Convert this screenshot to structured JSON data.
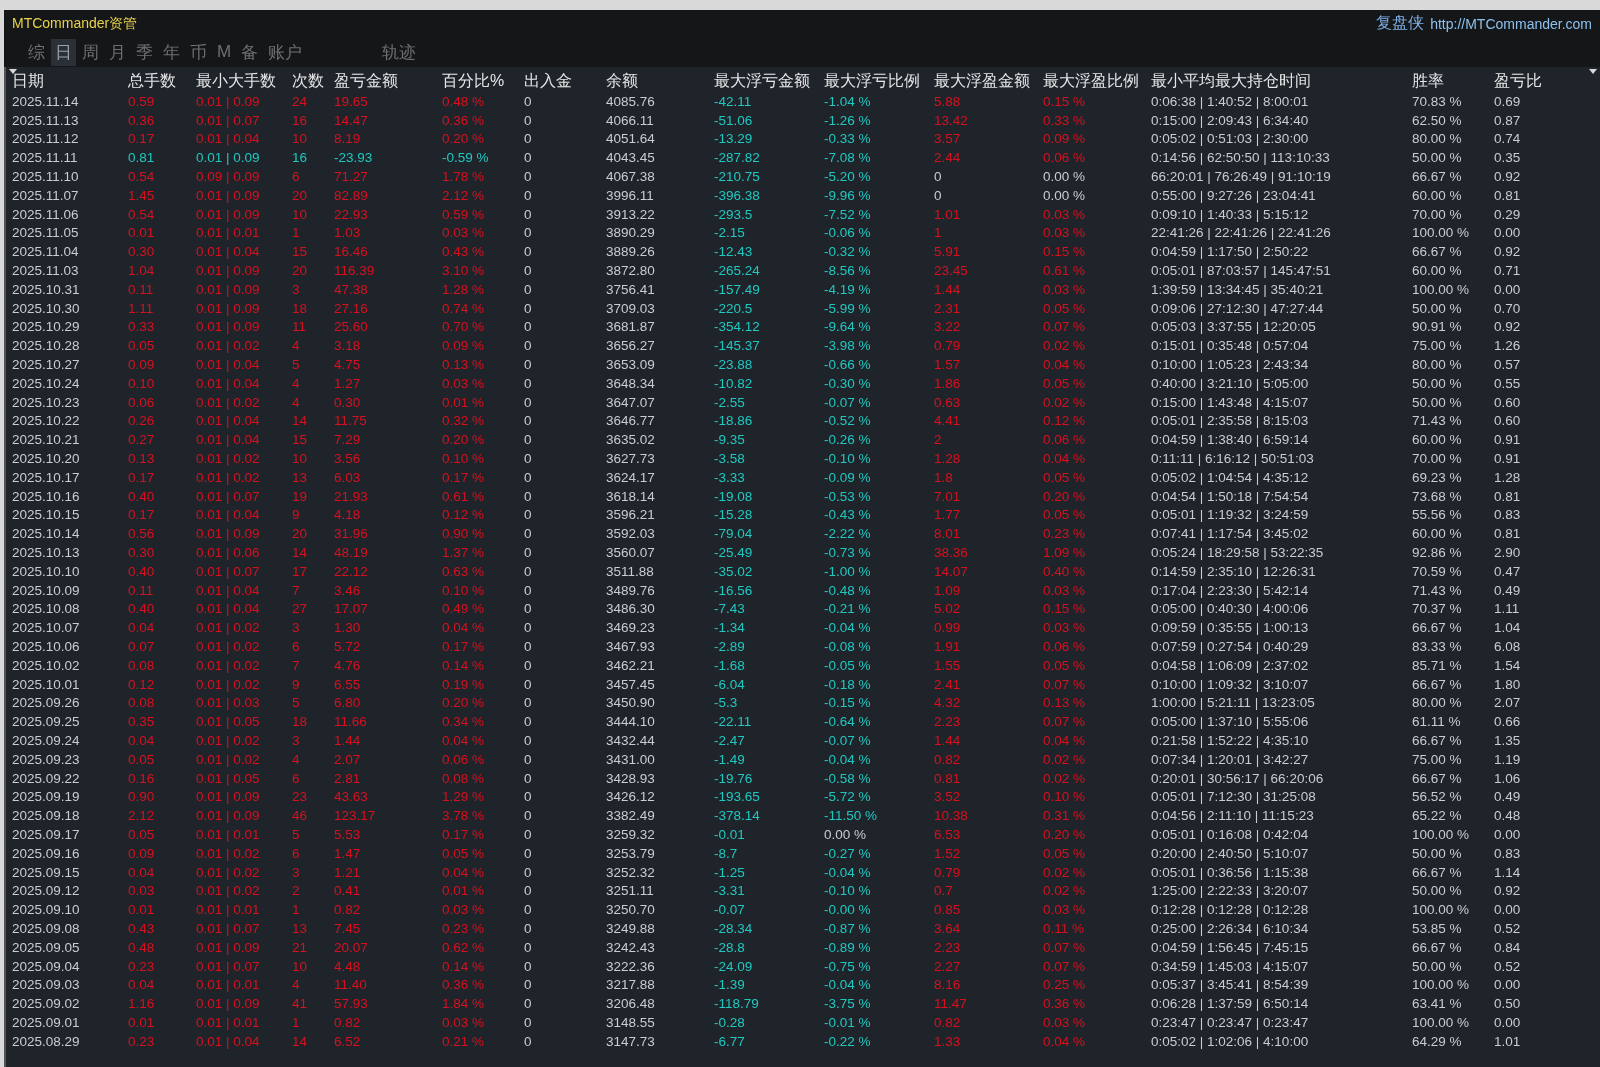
{
  "title_bar": {
    "app_title": "MTCommander资管",
    "brand": "复盘侠",
    "link": "http://MTCommander.com"
  },
  "tabs": [
    {
      "label": "综",
      "selected": false
    },
    {
      "label": "日",
      "selected": true
    },
    {
      "label": "周",
      "selected": false
    },
    {
      "label": "月",
      "selected": false
    },
    {
      "label": "季",
      "selected": false
    },
    {
      "label": "年",
      "selected": false
    },
    {
      "label": "币",
      "selected": false
    },
    {
      "label": "M",
      "selected": false
    },
    {
      "label": "备",
      "selected": false
    },
    {
      "label": "账户",
      "selected": false
    }
  ],
  "side_tabs": [
    {
      "label": "轨迹",
      "selected": false
    }
  ],
  "table": {
    "columns": [
      "日期",
      "总手数",
      "最小大手数",
      "次数",
      "盈亏金额",
      "百分比%",
      "出入金",
      "余额",
      "最大浮亏金额",
      "最大浮亏比例",
      "最大浮盈金额",
      "最大浮盈比例",
      "最小平均最大持仓时间",
      "胜率",
      "盈亏比"
    ],
    "rows": [
      {
        "color": "#d8101e",
        "cells": [
          "2025.11.14",
          "0.59",
          "0.01 | 0.09",
          "24",
          "19.65",
          "0.48 %",
          "0",
          "4085.76"
        ],
        "float_cells": [
          {
            "text": "-42.11",
            "color": "#20c8c0"
          },
          {
            "text": "-1.04 %",
            "color": "#20c8c0"
          },
          {
            "text": "5.88",
            "color": "#d8101e"
          },
          {
            "text": "0.15 %",
            "color": "#d8101e"
          }
        ],
        "tail_cells": [
          "0:06:38 | 1:40:52 | 8:00:01",
          "70.83 %",
          "0.69"
        ]
      },
      {
        "color": "#d8101e",
        "cells": [
          "2025.11.13",
          "0.36",
          "0.01 | 0.07",
          "16",
          "14.47",
          "0.36 %",
          "0",
          "4066.11"
        ],
        "float_cells": [
          {
            "text": "-51.06",
            "color": "#20c8c0"
          },
          {
            "text": "-1.26 %",
            "color": "#20c8c0"
          },
          {
            "text": "13.42",
            "color": "#d8101e"
          },
          {
            "text": "0.33 %",
            "color": "#d8101e"
          }
        ],
        "tail_cells": [
          "0:15:00 | 2:09:43 | 6:34:40",
          "62.50 %",
          "0.87"
        ]
      },
      {
        "color": "#d8101e",
        "cells": [
          "2025.11.12",
          "0.17",
          "0.01 | 0.04",
          "10",
          "8.19",
          "0.20 %",
          "0",
          "4051.64"
        ],
        "float_cells": [
          {
            "text": "-13.29",
            "color": "#20c8c0"
          },
          {
            "text": "-0.33 %",
            "color": "#20c8c0"
          },
          {
            "text": "3.57",
            "color": "#d8101e"
          },
          {
            "text": "0.09 %",
            "color": "#d8101e"
          }
        ],
        "tail_cells": [
          "0:05:02 | 0:51:03 | 2:30:00",
          "80.00 %",
          "0.74"
        ]
      },
      {
        "color": "#20c8c0",
        "cells": [
          "2025.11.11",
          "0.81",
          "0.01 | 0.09",
          "16",
          "-23.93",
          "-0.59 %",
          "0",
          "4043.45"
        ],
        "float_cells": [
          {
            "text": "-287.82",
            "color": "#20c8c0"
          },
          {
            "text": "-7.08 %",
            "color": "#20c8c0"
          },
          {
            "text": "2.44",
            "color": "#d8101e"
          },
          {
            "text": "0.06 %",
            "color": "#d8101e"
          }
        ],
        "tail_cells": [
          "0:14:56 | 62:50:50 | 113:10:33",
          "50.00 %",
          "0.35"
        ]
      },
      {
        "color": "#d8101e",
        "cells": [
          "2025.11.10",
          "0.54",
          "0.09 | 0.09",
          "6",
          "71.27",
          "1.78 %",
          "0",
          "4067.38"
        ],
        "float_cells": [
          {
            "text": "-210.75",
            "color": "#20c8c0"
          },
          {
            "text": "-5.20 %",
            "color": "#20c8c0"
          },
          {
            "text": "0",
            "color": "#c9ccd0"
          },
          {
            "text": "0.00 %",
            "color": "#c9ccd0"
          }
        ],
        "tail_cells": [
          "66:20:01 | 76:26:49 | 91:10:19",
          "66.67 %",
          "0.92"
        ]
      },
      {
        "color": "#d8101e",
        "cells": [
          "2025.11.07",
          "1.45",
          "0.01 | 0.09",
          "20",
          "82.89",
          "2.12 %",
          "0",
          "3996.11"
        ],
        "float_cells": [
          {
            "text": "-396.38",
            "color": "#20c8c0"
          },
          {
            "text": "-9.96 %",
            "color": "#20c8c0"
          },
          {
            "text": "0",
            "color": "#c9ccd0"
          },
          {
            "text": "0.00 %",
            "color": "#c9ccd0"
          }
        ],
        "tail_cells": [
          "0:55:00 | 9:27:26 | 23:04:41",
          "60.00 %",
          "0.81"
        ]
      },
      {
        "color": "#d8101e",
        "cells": [
          "2025.11.06",
          "0.54",
          "0.01 | 0.09",
          "10",
          "22.93",
          "0.59 %",
          "0",
          "3913.22"
        ],
        "float_cells": [
          {
            "text": "-293.5",
            "color": "#20c8c0"
          },
          {
            "text": "-7.52 %",
            "color": "#20c8c0"
          },
          {
            "text": "1.01",
            "color": "#d8101e"
          },
          {
            "text": "0.03 %",
            "color": "#d8101e"
          }
        ],
        "tail_cells": [
          "0:09:10 | 1:40:33 | 5:15:12",
          "70.00 %",
          "0.29"
        ]
      },
      {
        "color": "#d8101e",
        "cells": [
          "2025.11.05",
          "0.01",
          "0.01 | 0.01",
          "1",
          "1.03",
          "0.03 %",
          "0",
          "3890.29"
        ],
        "float_cells": [
          {
            "text": "-2.15",
            "color": "#20c8c0"
          },
          {
            "text": "-0.06 %",
            "color": "#20c8c0"
          },
          {
            "text": "1",
            "color": "#d8101e"
          },
          {
            "text": "0.03 %",
            "color": "#d8101e"
          }
        ],
        "tail_cells": [
          "22:41:26 | 22:41:26 | 22:41:26",
          "100.00 %",
          "0.00"
        ]
      },
      {
        "color": "#d8101e",
        "cells": [
          "2025.11.04",
          "0.30",
          "0.01 | 0.04",
          "15",
          "16.46",
          "0.43 %",
          "0",
          "3889.26"
        ],
        "float_cells": [
          {
            "text": "-12.43",
            "color": "#20c8c0"
          },
          {
            "text": "-0.32 %",
            "color": "#20c8c0"
          },
          {
            "text": "5.91",
            "color": "#d8101e"
          },
          {
            "text": "0.15 %",
            "color": "#d8101e"
          }
        ],
        "tail_cells": [
          "0:04:59 | 1:17:50 | 2:50:22",
          "66.67 %",
          "0.92"
        ]
      },
      {
        "color": "#d8101e",
        "cells": [
          "2025.11.03",
          "1.04",
          "0.01 | 0.09",
          "20",
          "116.39",
          "3.10 %",
          "0",
          "3872.80"
        ],
        "float_cells": [
          {
            "text": "-265.24",
            "color": "#20c8c0"
          },
          {
            "text": "-8.56 %",
            "color": "#20c8c0"
          },
          {
            "text": "23.45",
            "color": "#d8101e"
          },
          {
            "text": "0.61 %",
            "color": "#d8101e"
          }
        ],
        "tail_cells": [
          "0:05:01 | 87:03:57 | 145:47:51",
          "60.00 %",
          "0.71"
        ]
      },
      {
        "color": "#d8101e",
        "cells": [
          "2025.10.31",
          "0.11",
          "0.01 | 0.09",
          "3",
          "47.38",
          "1.28 %",
          "0",
          "3756.41"
        ],
        "float_cells": [
          {
            "text": "-157.49",
            "color": "#20c8c0"
          },
          {
            "text": "-4.19 %",
            "color": "#20c8c0"
          },
          {
            "text": "1.44",
            "color": "#d8101e"
          },
          {
            "text": "0.03 %",
            "color": "#d8101e"
          }
        ],
        "tail_cells": [
          "1:39:59 | 13:34:45 | 35:40:21",
          "100.00 %",
          "0.00"
        ]
      },
      {
        "color": "#d8101e",
        "cells": [
          "2025.10.30",
          "1.11",
          "0.01 | 0.09",
          "18",
          "27.16",
          "0.74 %",
          "0",
          "3709.03"
        ],
        "float_cells": [
          {
            "text": "-220.5",
            "color": "#20c8c0"
          },
          {
            "text": "-5.99 %",
            "color": "#20c8c0"
          },
          {
            "text": "2.31",
            "color": "#d8101e"
          },
          {
            "text": "0.05 %",
            "color": "#d8101e"
          }
        ],
        "tail_cells": [
          "0:09:06 | 27:12:30 | 47:27:44",
          "50.00 %",
          "0.70"
        ]
      },
      {
        "color": "#d8101e",
        "cells": [
          "2025.10.29",
          "0.33",
          "0.01 | 0.09",
          "11",
          "25.60",
          "0.70 %",
          "0",
          "3681.87"
        ],
        "float_cells": [
          {
            "text": "-354.12",
            "color": "#20c8c0"
          },
          {
            "text": "-9.64 %",
            "color": "#20c8c0"
          },
          {
            "text": "3.22",
            "color": "#d8101e"
          },
          {
            "text": "0.07 %",
            "color": "#d8101e"
          }
        ],
        "tail_cells": [
          "0:05:03 | 3:37:55 | 12:20:05",
          "90.91 %",
          "0.92"
        ]
      },
      {
        "color": "#d8101e",
        "cells": [
          "2025.10.28",
          "0.05",
          "0.01 | 0.02",
          "4",
          "3.18",
          "0.09 %",
          "0",
          "3656.27"
        ],
        "float_cells": [
          {
            "text": "-145.37",
            "color": "#20c8c0"
          },
          {
            "text": "-3.98 %",
            "color": "#20c8c0"
          },
          {
            "text": "0.79",
            "color": "#d8101e"
          },
          {
            "text": "0.02 %",
            "color": "#d8101e"
          }
        ],
        "tail_cells": [
          "0:15:01 | 0:35:48 | 0:57:04",
          "75.00 %",
          "1.26"
        ]
      },
      {
        "color": "#d8101e",
        "cells": [
          "2025.10.27",
          "0.09",
          "0.01 | 0.04",
          "5",
          "4.75",
          "0.13 %",
          "0",
          "3653.09"
        ],
        "float_cells": [
          {
            "text": "-23.88",
            "color": "#20c8c0"
          },
          {
            "text": "-0.66 %",
            "color": "#20c8c0"
          },
          {
            "text": "1.57",
            "color": "#d8101e"
          },
          {
            "text": "0.04 %",
            "color": "#d8101e"
          }
        ],
        "tail_cells": [
          "0:10:00 | 1:05:23 | 2:43:34",
          "80.00 %",
          "0.57"
        ]
      },
      {
        "color": "#d8101e",
        "cells": [
          "2025.10.24",
          "0.10",
          "0.01 | 0.04",
          "4",
          "1.27",
          "0.03 %",
          "0",
          "3648.34"
        ],
        "float_cells": [
          {
            "text": "-10.82",
            "color": "#20c8c0"
          },
          {
            "text": "-0.30 %",
            "color": "#20c8c0"
          },
          {
            "text": "1.86",
            "color": "#d8101e"
          },
          {
            "text": "0.05 %",
            "color": "#d8101e"
          }
        ],
        "tail_cells": [
          "0:40:00 | 3:21:10 | 5:05:00",
          "50.00 %",
          "0.55"
        ]
      },
      {
        "color": "#d8101e",
        "cells": [
          "2025.10.23",
          "0.06",
          "0.01 | 0.02",
          "4",
          "0.30",
          "0.01 %",
          "0",
          "3647.07"
        ],
        "float_cells": [
          {
            "text": "-2.55",
            "color": "#20c8c0"
          },
          {
            "text": "-0.07 %",
            "color": "#20c8c0"
          },
          {
            "text": "0.63",
            "color": "#d8101e"
          },
          {
            "text": "0.02 %",
            "color": "#d8101e"
          }
        ],
        "tail_cells": [
          "0:15:00 | 1:43:48 | 4:15:07",
          "50.00 %",
          "0.60"
        ]
      },
      {
        "color": "#d8101e",
        "cells": [
          "2025.10.22",
          "0.26",
          "0.01 | 0.04",
          "14",
          "11.75",
          "0.32 %",
          "0",
          "3646.77"
        ],
        "float_cells": [
          {
            "text": "-18.86",
            "color": "#20c8c0"
          },
          {
            "text": "-0.52 %",
            "color": "#20c8c0"
          },
          {
            "text": "4.41",
            "color": "#d8101e"
          },
          {
            "text": "0.12 %",
            "color": "#d8101e"
          }
        ],
        "tail_cells": [
          "0:05:01 | 2:35:58 | 8:15:03",
          "71.43 %",
          "0.60"
        ]
      },
      {
        "color": "#d8101e",
        "cells": [
          "2025.10.21",
          "0.27",
          "0.01 | 0.04",
          "15",
          "7.29",
          "0.20 %",
          "0",
          "3635.02"
        ],
        "float_cells": [
          {
            "text": "-9.35",
            "color": "#20c8c0"
          },
          {
            "text": "-0.26 %",
            "color": "#20c8c0"
          },
          {
            "text": "2",
            "color": "#d8101e"
          },
          {
            "text": "0.06 %",
            "color": "#d8101e"
          }
        ],
        "tail_cells": [
          "0:04:59 | 1:38:40 | 6:59:14",
          "60.00 %",
          "0.91"
        ]
      },
      {
        "color": "#d8101e",
        "cells": [
          "2025.10.20",
          "0.13",
          "0.01 | 0.02",
          "10",
          "3.56",
          "0.10 %",
          "0",
          "3627.73"
        ],
        "float_cells": [
          {
            "text": "-3.58",
            "color": "#20c8c0"
          },
          {
            "text": "-0.10 %",
            "color": "#20c8c0"
          },
          {
            "text": "1.28",
            "color": "#d8101e"
          },
          {
            "text": "0.04 %",
            "color": "#d8101e"
          }
        ],
        "tail_cells": [
          "0:11:11 | 6:16:12 | 50:51:03",
          "70.00 %",
          "0.91"
        ]
      },
      {
        "color": "#d8101e",
        "cells": [
          "2025.10.17",
          "0.17",
          "0.01 | 0.02",
          "13",
          "6.03",
          "0.17 %",
          "0",
          "3624.17"
        ],
        "float_cells": [
          {
            "text": "-3.33",
            "color": "#20c8c0"
          },
          {
            "text": "-0.09 %",
            "color": "#20c8c0"
          },
          {
            "text": "1.8",
            "color": "#d8101e"
          },
          {
            "text": "0.05 %",
            "color": "#d8101e"
          }
        ],
        "tail_cells": [
          "0:05:02 | 1:04:54 | 4:35:12",
          "69.23 %",
          "1.28"
        ]
      },
      {
        "color": "#d8101e",
        "cells": [
          "2025.10.16",
          "0.40",
          "0.01 | 0.07",
          "19",
          "21.93",
          "0.61 %",
          "0",
          "3618.14"
        ],
        "float_cells": [
          {
            "text": "-19.08",
            "color": "#20c8c0"
          },
          {
            "text": "-0.53 %",
            "color": "#20c8c0"
          },
          {
            "text": "7.01",
            "color": "#d8101e"
          },
          {
            "text": "0.20 %",
            "color": "#d8101e"
          }
        ],
        "tail_cells": [
          "0:04:54 | 1:50:18 | 7:54:54",
          "73.68 %",
          "0.81"
        ]
      },
      {
        "color": "#d8101e",
        "cells": [
          "2025.10.15",
          "0.17",
          "0.01 | 0.04",
          "9",
          "4.18",
          "0.12 %",
          "0",
          "3596.21"
        ],
        "float_cells": [
          {
            "text": "-15.28",
            "color": "#20c8c0"
          },
          {
            "text": "-0.43 %",
            "color": "#20c8c0"
          },
          {
            "text": "1.77",
            "color": "#d8101e"
          },
          {
            "text": "0.05 %",
            "color": "#d8101e"
          }
        ],
        "tail_cells": [
          "0:05:01 | 1:19:32 | 3:24:59",
          "55.56 %",
          "0.83"
        ]
      },
      {
        "color": "#d8101e",
        "cells": [
          "2025.10.14",
          "0.56",
          "0.01 | 0.09",
          "20",
          "31.96",
          "0.90 %",
          "0",
          "3592.03"
        ],
        "float_cells": [
          {
            "text": "-79.04",
            "color": "#20c8c0"
          },
          {
            "text": "-2.22 %",
            "color": "#20c8c0"
          },
          {
            "text": "8.01",
            "color": "#d8101e"
          },
          {
            "text": "0.23 %",
            "color": "#d8101e"
          }
        ],
        "tail_cells": [
          "0:07:41 | 1:17:54 | 3:45:02",
          "60.00 %",
          "0.81"
        ]
      },
      {
        "color": "#d8101e",
        "cells": [
          "2025.10.13",
          "0.30",
          "0.01 | 0.06",
          "14",
          "48.19",
          "1.37 %",
          "0",
          "3560.07"
        ],
        "float_cells": [
          {
            "text": "-25.49",
            "color": "#20c8c0"
          },
          {
            "text": "-0.73 %",
            "color": "#20c8c0"
          },
          {
            "text": "38.36",
            "color": "#d8101e"
          },
          {
            "text": "1.09 %",
            "color": "#d8101e"
          }
        ],
        "tail_cells": [
          "0:05:24 | 18:29:58 | 53:22:35",
          "92.86 %",
          "2.90"
        ]
      },
      {
        "color": "#d8101e",
        "cells": [
          "2025.10.10",
          "0.40",
          "0.01 | 0.07",
          "17",
          "22.12",
          "0.63 %",
          "0",
          "3511.88"
        ],
        "float_cells": [
          {
            "text": "-35.02",
            "color": "#20c8c0"
          },
          {
            "text": "-1.00 %",
            "color": "#20c8c0"
          },
          {
            "text": "14.07",
            "color": "#d8101e"
          },
          {
            "text": "0.40 %",
            "color": "#d8101e"
          }
        ],
        "tail_cells": [
          "0:14:59 | 2:35:10 | 12:26:31",
          "70.59 %",
          "0.47"
        ]
      },
      {
        "color": "#d8101e",
        "cells": [
          "2025.10.09",
          "0.11",
          "0.01 | 0.04",
          "7",
          "3.46",
          "0.10 %",
          "0",
          "3489.76"
        ],
        "float_cells": [
          {
            "text": "-16.56",
            "color": "#20c8c0"
          },
          {
            "text": "-0.48 %",
            "color": "#20c8c0"
          },
          {
            "text": "1.09",
            "color": "#d8101e"
          },
          {
            "text": "0.03 %",
            "color": "#d8101e"
          }
        ],
        "tail_cells": [
          "0:17:04 | 2:23:30 | 5:42:14",
          "71.43 %",
          "0.49"
        ]
      },
      {
        "color": "#d8101e",
        "cells": [
          "2025.10.08",
          "0.40",
          "0.01 | 0.04",
          "27",
          "17.07",
          "0.49 %",
          "0",
          "3486.30"
        ],
        "float_cells": [
          {
            "text": "-7.43",
            "color": "#20c8c0"
          },
          {
            "text": "-0.21 %",
            "color": "#20c8c0"
          },
          {
            "text": "5.02",
            "color": "#d8101e"
          },
          {
            "text": "0.15 %",
            "color": "#d8101e"
          }
        ],
        "tail_cells": [
          "0:05:00 | 0:40:30 | 4:00:06",
          "70.37 %",
          "1.11"
        ]
      },
      {
        "color": "#d8101e",
        "cells": [
          "2025.10.07",
          "0.04",
          "0.01 | 0.02",
          "3",
          "1.30",
          "0.04 %",
          "0",
          "3469.23"
        ],
        "float_cells": [
          {
            "text": "-1.34",
            "color": "#20c8c0"
          },
          {
            "text": "-0.04 %",
            "color": "#20c8c0"
          },
          {
            "text": "0.99",
            "color": "#d8101e"
          },
          {
            "text": "0.03 %",
            "color": "#d8101e"
          }
        ],
        "tail_cells": [
          "0:09:59 | 0:35:55 | 1:00:13",
          "66.67 %",
          "1.04"
        ]
      },
      {
        "color": "#d8101e",
        "cells": [
          "2025.10.06",
          "0.07",
          "0.01 | 0.02",
          "6",
          "5.72",
          "0.17 %",
          "0",
          "3467.93"
        ],
        "float_cells": [
          {
            "text": "-2.89",
            "color": "#20c8c0"
          },
          {
            "text": "-0.08 %",
            "color": "#20c8c0"
          },
          {
            "text": "1.91",
            "color": "#d8101e"
          },
          {
            "text": "0.06 %",
            "color": "#d8101e"
          }
        ],
        "tail_cells": [
          "0:07:59 | 0:27:54 | 0:40:29",
          "83.33 %",
          "6.08"
        ]
      },
      {
        "color": "#d8101e",
        "cells": [
          "2025.10.02",
          "0.08",
          "0.01 | 0.02",
          "7",
          "4.76",
          "0.14 %",
          "0",
          "3462.21"
        ],
        "float_cells": [
          {
            "text": "-1.68",
            "color": "#20c8c0"
          },
          {
            "text": "-0.05 %",
            "color": "#20c8c0"
          },
          {
            "text": "1.55",
            "color": "#d8101e"
          },
          {
            "text": "0.05 %",
            "color": "#d8101e"
          }
        ],
        "tail_cells": [
          "0:04:58 | 1:06:09 | 2:37:02",
          "85.71 %",
          "1.54"
        ]
      },
      {
        "color": "#d8101e",
        "cells": [
          "2025.10.01",
          "0.12",
          "0.01 | 0.02",
          "9",
          "6.55",
          "0.19 %",
          "0",
          "3457.45"
        ],
        "float_cells": [
          {
            "text": "-6.04",
            "color": "#20c8c0"
          },
          {
            "text": "-0.18 %",
            "color": "#20c8c0"
          },
          {
            "text": "2.41",
            "color": "#d8101e"
          },
          {
            "text": "0.07 %",
            "color": "#d8101e"
          }
        ],
        "tail_cells": [
          "0:10:00 | 1:09:32 | 3:10:07",
          "66.67 %",
          "1.80"
        ]
      },
      {
        "color": "#d8101e",
        "cells": [
          "2025.09.26",
          "0.08",
          "0.01 | 0.03",
          "5",
          "6.80",
          "0.20 %",
          "0",
          "3450.90"
        ],
        "float_cells": [
          {
            "text": "-5.3",
            "color": "#20c8c0"
          },
          {
            "text": "-0.15 %",
            "color": "#20c8c0"
          },
          {
            "text": "4.32",
            "color": "#d8101e"
          },
          {
            "text": "0.13 %",
            "color": "#d8101e"
          }
        ],
        "tail_cells": [
          "1:00:00 | 5:21:11 | 13:23:05",
          "80.00 %",
          "2.07"
        ]
      },
      {
        "color": "#d8101e",
        "cells": [
          "2025.09.25",
          "0.35",
          "0.01 | 0.05",
          "18",
          "11.66",
          "0.34 %",
          "0",
          "3444.10"
        ],
        "float_cells": [
          {
            "text": "-22.11",
            "color": "#20c8c0"
          },
          {
            "text": "-0.64 %",
            "color": "#20c8c0"
          },
          {
            "text": "2.23",
            "color": "#d8101e"
          },
          {
            "text": "0.07 %",
            "color": "#d8101e"
          }
        ],
        "tail_cells": [
          "0:05:00 | 1:37:10 | 5:55:06",
          "61.11 %",
          "0.66"
        ]
      },
      {
        "color": "#d8101e",
        "cells": [
          "2025.09.24",
          "0.04",
          "0.01 | 0.02",
          "3",
          "1.44",
          "0.04 %",
          "0",
          "3432.44"
        ],
        "float_cells": [
          {
            "text": "-2.47",
            "color": "#20c8c0"
          },
          {
            "text": "-0.07 %",
            "color": "#20c8c0"
          },
          {
            "text": "1.44",
            "color": "#d8101e"
          },
          {
            "text": "0.04 %",
            "color": "#d8101e"
          }
        ],
        "tail_cells": [
          "0:21:58 | 1:52:22 | 4:35:10",
          "66.67 %",
          "1.35"
        ]
      },
      {
        "color": "#d8101e",
        "cells": [
          "2025.09.23",
          "0.05",
          "0.01 | 0.02",
          "4",
          "2.07",
          "0.06 %",
          "0",
          "3431.00"
        ],
        "float_cells": [
          {
            "text": "-1.49",
            "color": "#20c8c0"
          },
          {
            "text": "-0.04 %",
            "color": "#20c8c0"
          },
          {
            "text": "0.82",
            "color": "#d8101e"
          },
          {
            "text": "0.02 %",
            "color": "#d8101e"
          }
        ],
        "tail_cells": [
          "0:07:34 | 1:20:01 | 3:42:27",
          "75.00 %",
          "1.19"
        ]
      },
      {
        "color": "#d8101e",
        "cells": [
          "2025.09.22",
          "0.16",
          "0.01 | 0.05",
          "6",
          "2.81",
          "0.08 %",
          "0",
          "3428.93"
        ],
        "float_cells": [
          {
            "text": "-19.76",
            "color": "#20c8c0"
          },
          {
            "text": "-0.58 %",
            "color": "#20c8c0"
          },
          {
            "text": "0.81",
            "color": "#d8101e"
          },
          {
            "text": "0.02 %",
            "color": "#d8101e"
          }
        ],
        "tail_cells": [
          "0:20:01 | 30:56:17 | 66:20:06",
          "66.67 %",
          "1.06"
        ]
      },
      {
        "color": "#d8101e",
        "cells": [
          "2025.09.19",
          "0.90",
          "0.01 | 0.09",
          "23",
          "43.63",
          "1.29 %",
          "0",
          "3426.12"
        ],
        "float_cells": [
          {
            "text": "-193.65",
            "color": "#20c8c0"
          },
          {
            "text": "-5.72 %",
            "color": "#20c8c0"
          },
          {
            "text": "3.52",
            "color": "#d8101e"
          },
          {
            "text": "0.10 %",
            "color": "#d8101e"
          }
        ],
        "tail_cells": [
          "0:05:01 | 7:12:30 | 31:25:08",
          "56.52 %",
          "0.49"
        ]
      },
      {
        "color": "#d8101e",
        "cells": [
          "2025.09.18",
          "2.12",
          "0.01 | 0.09",
          "46",
          "123.17",
          "3.78 %",
          "0",
          "3382.49"
        ],
        "float_cells": [
          {
            "text": "-378.14",
            "color": "#20c8c0"
          },
          {
            "text": "-11.50 %",
            "color": "#20c8c0"
          },
          {
            "text": "10.38",
            "color": "#d8101e"
          },
          {
            "text": "0.31 %",
            "color": "#d8101e"
          }
        ],
        "tail_cells": [
          "0:04:56 | 2:11:10 | 11:15:23",
          "65.22 %",
          "0.48"
        ]
      },
      {
        "color": "#d8101e",
        "cells": [
          "2025.09.17",
          "0.05",
          "0.01 | 0.01",
          "5",
          "5.53",
          "0.17 %",
          "0",
          "3259.32"
        ],
        "float_cells": [
          {
            "text": "-0.01",
            "color": "#20c8c0"
          },
          {
            "text": "0.00 %",
            "color": "#c9ccd0"
          },
          {
            "text": "6.53",
            "color": "#d8101e"
          },
          {
            "text": "0.20 %",
            "color": "#d8101e"
          }
        ],
        "tail_cells": [
          "0:05:01 | 0:16:08 | 0:42:04",
          "100.00 %",
          "0.00"
        ]
      },
      {
        "color": "#d8101e",
        "cells": [
          "2025.09.16",
          "0.09",
          "0.01 | 0.02",
          "6",
          "1.47",
          "0.05 %",
          "0",
          "3253.79"
        ],
        "float_cells": [
          {
            "text": "-8.7",
            "color": "#20c8c0"
          },
          {
            "text": "-0.27 %",
            "color": "#20c8c0"
          },
          {
            "text": "1.52",
            "color": "#d8101e"
          },
          {
            "text": "0.05 %",
            "color": "#d8101e"
          }
        ],
        "tail_cells": [
          "0:20:00 | 2:40:50 | 5:10:07",
          "50.00 %",
          "0.83"
        ]
      },
      {
        "color": "#d8101e",
        "cells": [
          "2025.09.15",
          "0.04",
          "0.01 | 0.02",
          "3",
          "1.21",
          "0.04 %",
          "0",
          "3252.32"
        ],
        "float_cells": [
          {
            "text": "-1.25",
            "color": "#20c8c0"
          },
          {
            "text": "-0.04 %",
            "color": "#20c8c0"
          },
          {
            "text": "0.79",
            "color": "#d8101e"
          },
          {
            "text": "0.02 %",
            "color": "#d8101e"
          }
        ],
        "tail_cells": [
          "0:05:01 | 0:36:56 | 1:15:38",
          "66.67 %",
          "1.14"
        ]
      },
      {
        "color": "#d8101e",
        "cells": [
          "2025.09.12",
          "0.03",
          "0.01 | 0.02",
          "2",
          "0.41",
          "0.01 %",
          "0",
          "3251.11"
        ],
        "float_cells": [
          {
            "text": "-3.31",
            "color": "#20c8c0"
          },
          {
            "text": "-0.10 %",
            "color": "#20c8c0"
          },
          {
            "text": "0.7",
            "color": "#d8101e"
          },
          {
            "text": "0.02 %",
            "color": "#d8101e"
          }
        ],
        "tail_cells": [
          "1:25:00 | 2:22:33 | 3:20:07",
          "50.00 %",
          "0.92"
        ]
      },
      {
        "color": "#d8101e",
        "cells": [
          "2025.09.10",
          "0.01",
          "0.01 | 0.01",
          "1",
          "0.82",
          "0.03 %",
          "0",
          "3250.70"
        ],
        "float_cells": [
          {
            "text": "-0.07",
            "color": "#20c8c0"
          },
          {
            "text": "-0.00 %",
            "color": "#20c8c0"
          },
          {
            "text": "0.85",
            "color": "#d8101e"
          },
          {
            "text": "0.03 %",
            "color": "#d8101e"
          }
        ],
        "tail_cells": [
          "0:12:28 | 0:12:28 | 0:12:28",
          "100.00 %",
          "0.00"
        ]
      },
      {
        "color": "#d8101e",
        "cells": [
          "2025.09.08",
          "0.43",
          "0.01 | 0.07",
          "13",
          "7.45",
          "0.23 %",
          "0",
          "3249.88"
        ],
        "float_cells": [
          {
            "text": "-28.34",
            "color": "#20c8c0"
          },
          {
            "text": "-0.87 %",
            "color": "#20c8c0"
          },
          {
            "text": "3.64",
            "color": "#d8101e"
          },
          {
            "text": "0.11 %",
            "color": "#d8101e"
          }
        ],
        "tail_cells": [
          "0:25:00 | 2:26:34 | 6:10:34",
          "53.85 %",
          "0.52"
        ]
      },
      {
        "color": "#d8101e",
        "cells": [
          "2025.09.05",
          "0.48",
          "0.01 | 0.09",
          "21",
          "20.07",
          "0.62 %",
          "0",
          "3242.43"
        ],
        "float_cells": [
          {
            "text": "-28.8",
            "color": "#20c8c0"
          },
          {
            "text": "-0.89 %",
            "color": "#20c8c0"
          },
          {
            "text": "2.23",
            "color": "#d8101e"
          },
          {
            "text": "0.07 %",
            "color": "#d8101e"
          }
        ],
        "tail_cells": [
          "0:04:59 | 1:56:45 | 7:45:15",
          "66.67 %",
          "0.84"
        ]
      },
      {
        "color": "#d8101e",
        "cells": [
          "2025.09.04",
          "0.23",
          "0.01 | 0.07",
          "10",
          "4.48",
          "0.14 %",
          "0",
          "3222.36"
        ],
        "float_cells": [
          {
            "text": "-24.09",
            "color": "#20c8c0"
          },
          {
            "text": "-0.75 %",
            "color": "#20c8c0"
          },
          {
            "text": "2.27",
            "color": "#d8101e"
          },
          {
            "text": "0.07 %",
            "color": "#d8101e"
          }
        ],
        "tail_cells": [
          "0:34:59 | 1:45:03 | 4:15:07",
          "50.00 %",
          "0.52"
        ]
      },
      {
        "color": "#d8101e",
        "cells": [
          "2025.09.03",
          "0.04",
          "0.01 | 0.01",
          "4",
          "11.40",
          "0.36 %",
          "0",
          "3217.88"
        ],
        "float_cells": [
          {
            "text": "-1.39",
            "color": "#20c8c0"
          },
          {
            "text": "-0.04 %",
            "color": "#20c8c0"
          },
          {
            "text": "8.16",
            "color": "#d8101e"
          },
          {
            "text": "0.25 %",
            "color": "#d8101e"
          }
        ],
        "tail_cells": [
          "0:05:37 | 3:45:41 | 8:54:39",
          "100.00 %",
          "0.00"
        ]
      },
      {
        "color": "#d8101e",
        "cells": [
          "2025.09.02",
          "1.16",
          "0.01 | 0.09",
          "41",
          "57.93",
          "1.84 %",
          "0",
          "3206.48"
        ],
        "float_cells": [
          {
            "text": "-118.79",
            "color": "#20c8c0"
          },
          {
            "text": "-3.75 %",
            "color": "#20c8c0"
          },
          {
            "text": "11.47",
            "color": "#d8101e"
          },
          {
            "text": "0.36 %",
            "color": "#d8101e"
          }
        ],
        "tail_cells": [
          "0:06:28 | 1:37:59 | 6:50:14",
          "63.41 %",
          "0.50"
        ]
      },
      {
        "color": "#d8101e",
        "cells": [
          "2025.09.01",
          "0.01",
          "0.01 | 0.01",
          "1",
          "0.82",
          "0.03 %",
          "0",
          "3148.55"
        ],
        "float_cells": [
          {
            "text": "-0.28",
            "color": "#20c8c0"
          },
          {
            "text": "-0.01 %",
            "color": "#20c8c0"
          },
          {
            "text": "0.82",
            "color": "#d8101e"
          },
          {
            "text": "0.03 %",
            "color": "#d8101e"
          }
        ],
        "tail_cells": [
          "0:23:47 | 0:23:47 | 0:23:47",
          "100.00 %",
          "0.00"
        ]
      },
      {
        "color": "#d8101e",
        "cells": [
          "2025.08.29",
          "0.23",
          "0.01 | 0.04",
          "14",
          "6.52",
          "0.21 %",
          "0",
          "3147.73"
        ],
        "float_cells": [
          {
            "text": "-6.77",
            "color": "#20c8c0"
          },
          {
            "text": "-0.22 %",
            "color": "#20c8c0"
          },
          {
            "text": "1.33",
            "color": "#d8101e"
          },
          {
            "text": "0.04 %",
            "color": "#d8101e"
          }
        ],
        "tail_cells": [
          "0:05:02 | 1:02:06 | 4:10:00",
          "64.29 %",
          "1.01"
        ]
      }
    ]
  }
}
